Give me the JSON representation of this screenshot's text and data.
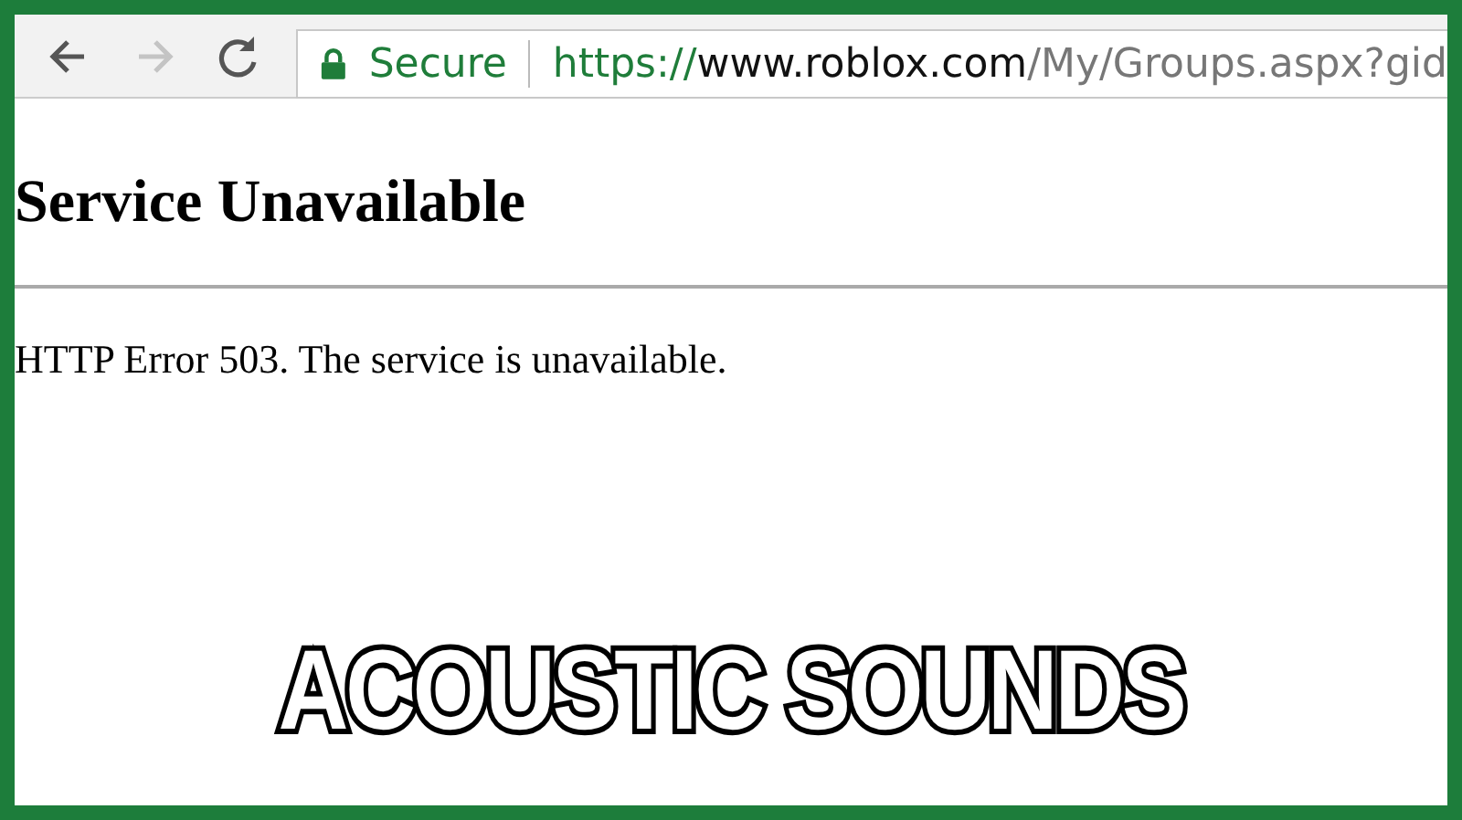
{
  "toolbar": {
    "buttons": [
      {
        "kind": "back",
        "disabled": false
      },
      {
        "kind": "forward",
        "disabled": true
      },
      {
        "kind": "reload",
        "disabled": false
      }
    ]
  },
  "address_bar": {
    "security": "Secure",
    "url": {
      "scheme": "https://",
      "host": "www.roblox.com",
      "path": "/My/Groups.aspx?gid"
    }
  },
  "page": {
    "heading": "Service Unavailable",
    "message": "HTTP Error 503. The service is unavailable."
  },
  "caption": "ACOUSTIC SOUNDS"
}
